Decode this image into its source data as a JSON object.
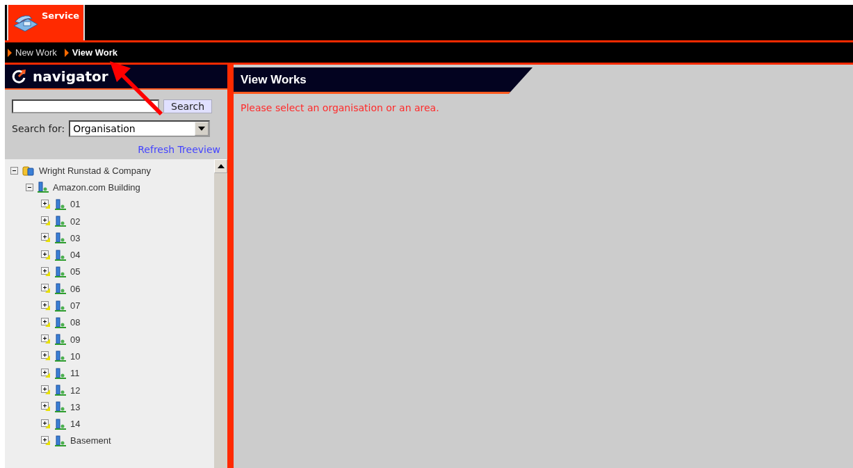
{
  "app_tab": {
    "label": "Service",
    "selected": true
  },
  "breadcrumb": [
    {
      "label": "New Work",
      "selected": false
    },
    {
      "label": "View Work",
      "selected": true
    }
  ],
  "navigator": {
    "title": "navigator",
    "search": {
      "button": "Search"
    },
    "search_for": {
      "label": "Search for:",
      "value": "Organisation"
    },
    "refresh_link": "Refresh Treeview",
    "tree": [
      {
        "label": "Wright Runstad & Company",
        "kind": "organisation",
        "expanded": true,
        "children": [
          {
            "label": "Amazon.com Building",
            "kind": "building",
            "expanded": true,
            "children": [
              {
                "label": "01",
                "kind": "floor",
                "expanded": false
              },
              {
                "label": "02",
                "kind": "floor",
                "expanded": false
              },
              {
                "label": "03",
                "kind": "floor",
                "expanded": false
              },
              {
                "label": "04",
                "kind": "floor",
                "expanded": false
              },
              {
                "label": "05",
                "kind": "floor",
                "expanded": false
              },
              {
                "label": "06",
                "kind": "floor",
                "expanded": false
              },
              {
                "label": "07",
                "kind": "floor",
                "expanded": false
              },
              {
                "label": "08",
                "kind": "floor",
                "expanded": false
              },
              {
                "label": "09",
                "kind": "floor",
                "expanded": false
              },
              {
                "label": "10",
                "kind": "floor",
                "expanded": false
              },
              {
                "label": "11",
                "kind": "floor",
                "expanded": false
              },
              {
                "label": "12",
                "kind": "floor",
                "expanded": false
              },
              {
                "label": "13",
                "kind": "floor",
                "expanded": false
              },
              {
                "label": "14",
                "kind": "floor",
                "expanded": false
              },
              {
                "label": "Basement",
                "kind": "floor",
                "expanded": false
              }
            ]
          }
        ]
      }
    ]
  },
  "main": {
    "title": "View Works",
    "message": "Please select an organisation or an area."
  }
}
